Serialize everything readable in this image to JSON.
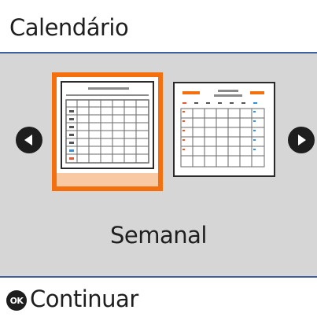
{
  "header": {
    "title": "Calendário"
  },
  "main": {
    "options": [
      {
        "id": "weekly",
        "selected": true,
        "icon": "weekly-calendar-icon"
      },
      {
        "id": "monthly",
        "selected": false,
        "icon": "monthly-calendar-icon"
      }
    ],
    "selected_label": "Semanal",
    "left_arrow_icon": "arrow-left-icon",
    "right_arrow_icon": "arrow-right-icon"
  },
  "footer": {
    "ok_badge": "OK",
    "action_label": "Continuar"
  },
  "colors": {
    "accent": "#f4700e",
    "accent_light": "#f9c9a3",
    "divider": "#3f5fa0",
    "panel": "#d6d6d6",
    "text": "#1e1e1e"
  }
}
